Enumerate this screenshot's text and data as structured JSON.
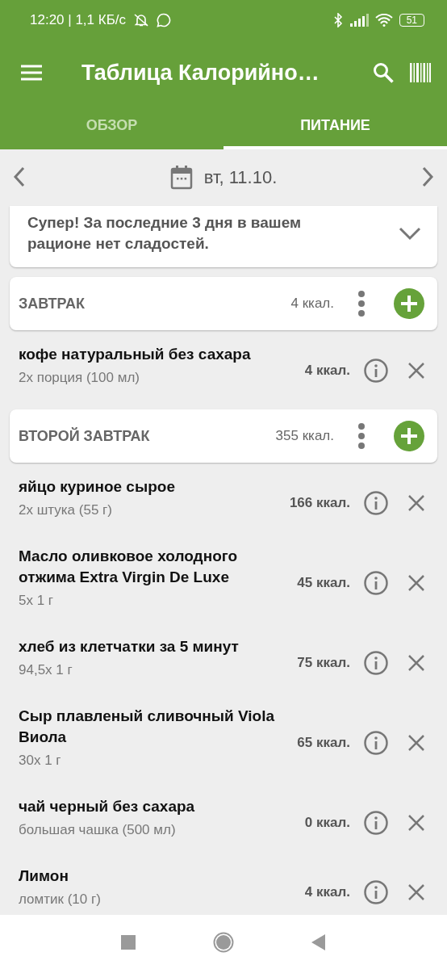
{
  "status_bar": {
    "time": "12:20 | 1,1 КБ/с",
    "battery": "51"
  },
  "toolbar": {
    "title": "Таблица Калорийно…"
  },
  "tabs": [
    {
      "label": "ОБЗОР",
      "selected": false
    },
    {
      "label": "ПИТАНИЕ",
      "selected": true
    }
  ],
  "date": "вт, 11.10.",
  "tip": {
    "text": "Супер! За последние 3 дня в вашем рационе нет сладостей.",
    "expanded": false
  },
  "meals": [
    {
      "title": "ЗАВТРАК",
      "kcal": "4 ккал.",
      "items": [
        {
          "name": "кофе натуральный без сахара",
          "portion": "2x порция (100 мл)",
          "kcal": "4 ккал."
        }
      ]
    },
    {
      "title": "ВТОРОЙ ЗАВТРАК",
      "kcal": "355 ккал.",
      "items": [
        {
          "name": "яйцо куриное сырое",
          "portion": "2x штука (55 г)",
          "kcal": "166 ккал."
        },
        {
          "name": "Масло оливковое холодного отжима Extra Virgin De Luxe",
          "portion": "5x 1 г",
          "kcal": "45 ккал."
        },
        {
          "name": "хлеб из клетчатки за 5 минут",
          "portion": "94,5x 1 г",
          "kcal": "75 ккал."
        },
        {
          "name": "Сыр плавленый сливочный Viola Виола",
          "portion": "30x 1 г",
          "kcal": "65 ккал."
        },
        {
          "name": "чай черный без сахара",
          "portion": "большая чашка (500 мл)",
          "kcal": "0 ккал."
        },
        {
          "name": "Лимон",
          "portion": "ломтик (10 г)",
          "kcal": "4 ккал."
        }
      ]
    }
  ]
}
